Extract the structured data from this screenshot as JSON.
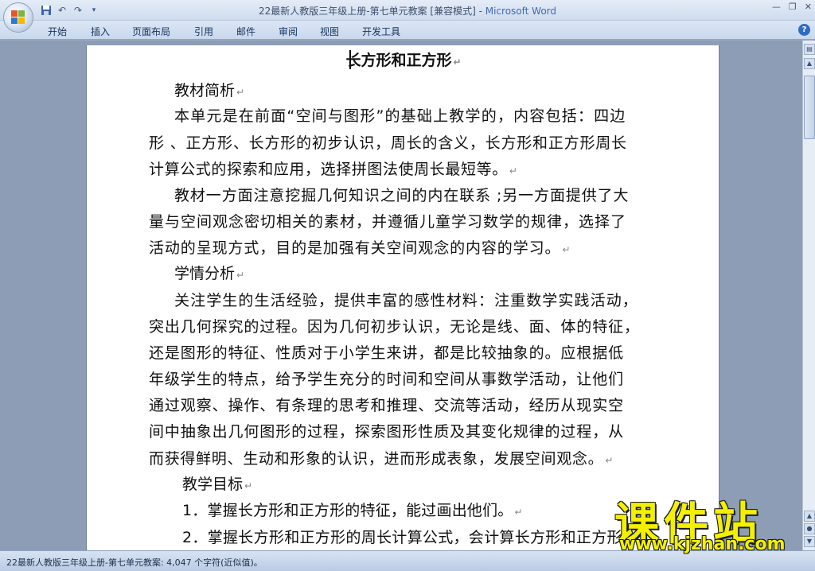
{
  "titlebar": {
    "title": "22最新人教版三年级上册-第七单元教案 [兼容模式]",
    "separator": " - ",
    "app_name": "Microsoft Word",
    "qat_icons": [
      "save-icon",
      "undo-icon",
      "redo-icon",
      "customize-qat-icon"
    ],
    "window_controls": [
      "minimize",
      "restore",
      "close"
    ]
  },
  "ribbon": {
    "tabs": [
      "开始",
      "插入",
      "页面布局",
      "引用",
      "邮件",
      "审阅",
      "视图",
      "开发工具"
    ],
    "help_icon": "?"
  },
  "document": {
    "heading": "长方形和正方形",
    "lines": [
      {
        "text": "教材简析",
        "mark": true
      },
      {
        "text": "本单元是在前面“空间与图形”的基础上教学的，内容包括：四边"
      },
      {
        "text": "形 、正方形、长方形的初步认识，周长的含义，长方形和正方形周长"
      },
      {
        "text": "计算公式的探索和应用，选择拼图法使周长最短等。",
        "mark": true
      },
      {
        "text": "教材一方面注意挖掘几何知识之间的内在联系 ;另一方面提供了大"
      },
      {
        "text": "量与空间观念密切相关的素材，并遵循儿童学习数学的规律，选择了"
      },
      {
        "text": "活动的呈现方式，目的是加强有关空间观念的内容的学习。",
        "mark": true
      },
      {
        "text": "学情分析",
        "mark": true
      },
      {
        "text": "关注学生的生活经验，提供丰富的感性材料：注重数学实践活动，"
      },
      {
        "text": "突出几何探究的过程。因为几何初步认识，无论是线、面、体的特征，"
      },
      {
        "text": "还是图形的特征、性质对于小学生来讲，都是比较抽象的。应根据低"
      },
      {
        "text": "年级学生的特点，给予学生充分的时间和空间从事数学活动，让他们"
      },
      {
        "text": "通过观察、操作、有条理的思考和推理、交流等活动，经历从现实空"
      },
      {
        "text": "间中抽象出几何图形的过程，探索图形性质及其变化规律的过程，从"
      },
      {
        "text": "而获得鲜明、生动和形象的认识，进而形成表象，发展空间观念。",
        "mark": true
      },
      {
        "text": "教学目标",
        "mark": true
      },
      {
        "text": "1．掌握长方形和正方形的特征，能过画出他们。",
        "mark": true
      },
      {
        "text": "2．掌握长方形和正方形的周长计算公式，会计算长方形和正方形"
      }
    ],
    "paragraph_mark": "↵"
  },
  "statusbar": {
    "text": "22最新人教版三年级上册-第七单元教案: 4,047 个字符(近似值)。"
  },
  "watermark": {
    "big": "课件站",
    "url": "www.kjzhan.com"
  },
  "colors": {
    "ribbon_bg": "#dbe6f4",
    "workspace_bg": "#8d9db5",
    "watermark_yellow": "#f3f000",
    "app_name_blue": "#3e6bb5"
  }
}
